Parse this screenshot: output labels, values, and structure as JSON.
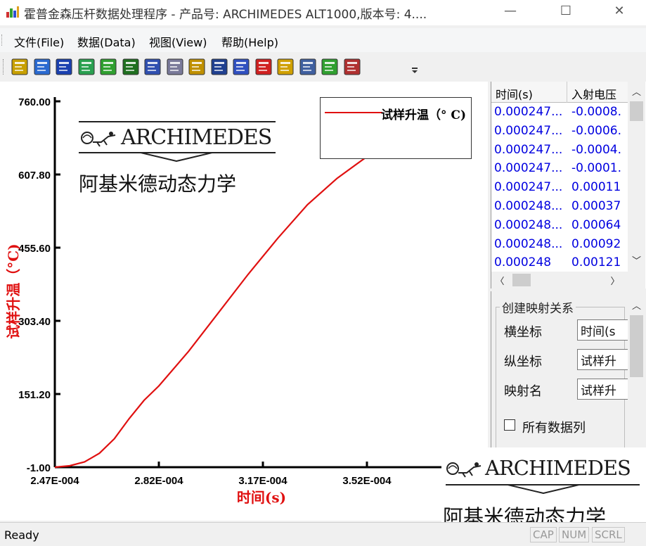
{
  "window": {
    "title": "霍普金森压杆数据处理程序 - 产品号: ARCHIMEDES ALT1000,版本号: 4....",
    "minimize": "—",
    "maximize": "☐",
    "close": "✕"
  },
  "menu": [
    "文件(File)",
    "数据(Data)",
    "视图(View)",
    "帮助(Help)"
  ],
  "toolbar": {
    "buttons": [
      "open-icon",
      "open-folder-icon",
      "save-icon",
      "refresh-icon",
      "axis-x-icon",
      "chart-icon",
      "form-icon",
      "export-icon",
      "graph-icon",
      "disk-icon",
      "table-icon",
      "stop-icon",
      "help-icon",
      "notes-icon",
      "step-2-icon",
      "step-3-icon"
    ],
    "colors": [
      "#c8a000",
      "#2a6ad0",
      "#1a40b0",
      "#2aa050",
      "#30a030",
      "#207020",
      "#3050b0",
      "#7a7a9a",
      "#c09000",
      "#204090",
      "#3050c0",
      "#d02020",
      "#d0a000",
      "#4060a0",
      "#30a030",
      "#b03030"
    ]
  },
  "chart_data": {
    "type": "line",
    "title": "",
    "xlabel": "时间(s)",
    "ylabel": "试样升温（°C)",
    "ylim": [
      -1.0,
      760.0
    ],
    "yticks": [
      "-1.00",
      "151.20",
      "303.40",
      "455.60",
      "607.80",
      "760.00"
    ],
    "xticks": [
      "2.47E-004",
      "2.82E-004",
      "3.17E-004",
      "3.52E-004",
      "3."
    ],
    "series": [
      {
        "name": "试样升温（° C)",
        "color": "#e01010",
        "x": [
          0.000247,
          0.000252,
          0.000257,
          0.000262,
          0.000267,
          0.000272,
          0.000277,
          0.000282,
          0.000292,
          0.000302,
          0.000312,
          0.000322,
          0.000332,
          0.000342,
          0.000352,
          0.000362,
          0.000372,
          0.000377,
          0.000382,
          0.000386
        ],
        "y": [
          -1,
          2,
          10,
          28,
          58,
          100,
          138,
          168,
          240,
          320,
          400,
          475,
          545,
          600,
          645,
          690,
          735,
          752,
          758,
          756
        ]
      }
    ],
    "legend": "top-right",
    "grid": false
  },
  "plot_logo": {
    "brand": "ARCHIMEDES",
    "chinese": "阿基米德动态力学"
  },
  "grid": {
    "columns": [
      "时间(s)",
      "入射电压"
    ],
    "rows": [
      [
        "0.000247...",
        "-0.0008."
      ],
      [
        "0.000247...",
        "-0.0006."
      ],
      [
        "0.000247...",
        "-0.0004."
      ],
      [
        "0.000247...",
        "-0.0001."
      ],
      [
        "0.000247...",
        "0.00011"
      ],
      [
        "0.000248...",
        "0.00037"
      ],
      [
        "0.000248...",
        "0.00064"
      ],
      [
        "0.000248...",
        "0.00092"
      ],
      [
        "0.000248",
        "0.00121"
      ]
    ]
  },
  "mapping": {
    "group_title": "创建映射关系",
    "x_label": "横坐标",
    "x_value": "时间(s",
    "y_label": "纵坐标",
    "y_value": "试样升",
    "name_label": "映射名",
    "name_value": "试样升",
    "checkbox_label": "所有数据列"
  },
  "overlay_logo": {
    "brand": "ARCHIMEDES",
    "chinese": "阿基米德动态力学"
  },
  "status": {
    "text": "Ready",
    "cap": "CAP",
    "num": "NUM",
    "scrl": "SCRL"
  }
}
